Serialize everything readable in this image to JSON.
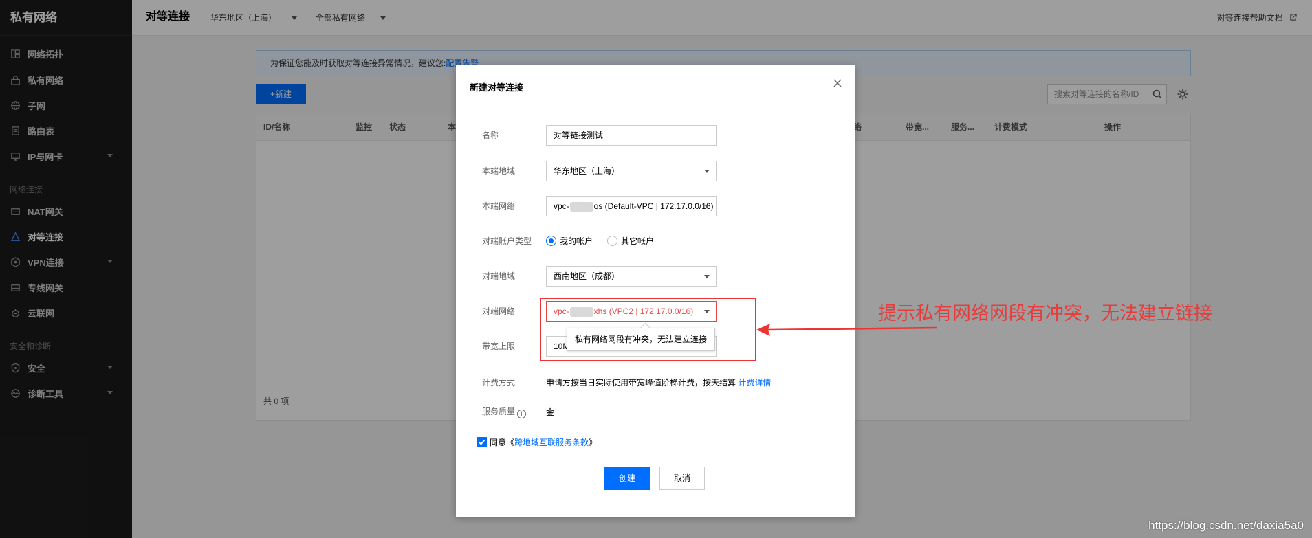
{
  "sidebar": {
    "brand": "私有网络",
    "items": [
      {
        "label": "网络拓扑",
        "icon": "topology-icon"
      },
      {
        "label": "私有网络",
        "icon": "lock-icon"
      },
      {
        "label": "子网",
        "icon": "globe-icon"
      },
      {
        "label": "路由表",
        "icon": "document-icon"
      },
      {
        "label": "IP与网卡",
        "icon": "network-card-icon"
      },
      {
        "label": "NAT网关",
        "icon": "gateway-icon"
      },
      {
        "label": "对等连接",
        "icon": "peering-icon"
      },
      {
        "label": "VPN连接",
        "icon": "vpn-icon"
      },
      {
        "label": "专线网关",
        "icon": "gateway-icon"
      },
      {
        "label": "云联网",
        "icon": "cloud-link-icon"
      },
      {
        "label": "安全",
        "icon": "shield-icon"
      },
      {
        "label": "诊断工具",
        "icon": "diagnose-icon"
      }
    ],
    "groups": [
      "网络连接",
      "安全和诊断"
    ]
  },
  "header": {
    "title": "对等连接",
    "region": "华东地区（上海）",
    "vpc_filter": "全部私有网络",
    "help": "对等连接帮助文档"
  },
  "notice": {
    "text": "为保证您能及时获取对等连接异常情况，建议您:",
    "link": "配置告警"
  },
  "toolbar": {
    "new_label": "+新建",
    "search_placeholder": "搜索对等连接的名称/ID"
  },
  "table": {
    "columns": [
      "ID/名称",
      "监控",
      "状态",
      "本",
      "络",
      "带宽...",
      "服务...",
      "计费模式",
      "操作"
    ],
    "total": "共 0 项"
  },
  "dialog": {
    "title": "新建对等连接",
    "name_label": "名称",
    "name_value": "对等链接测试",
    "local_region_label": "本端地域",
    "local_region_value": "华东地区（上海）",
    "local_vpc_label": "本端网络",
    "local_vpc_prefix": "vpc-",
    "local_vpc_suffix": "os (Default-VPC | 172.17.0.0/16)",
    "peer_account_label": "对端账户类型",
    "account_mine": "我的帐户",
    "account_other": "其它帐户",
    "peer_region_label": "对端地域",
    "peer_region_value": "西南地区（成都）",
    "peer_vpc_label": "对端网络",
    "peer_vpc_prefix": "vpc-",
    "peer_vpc_suffix": "xhs (VPC2 | 172.17.0.0/16)",
    "bandwidth_label": "带宽上限",
    "bandwidth_value": "10M",
    "tooltip": "私有网络网段有冲突，无法建立连接",
    "billing_label": "计费方式",
    "billing_text": "申请方按当日实际使用带宽峰值阶梯计费，按天结算",
    "billing_link": "计费详情",
    "quality_label": "服务质量",
    "quality_value": "金",
    "agree_text": "同意《",
    "agree_link": "跨地域互联服务条款",
    "agree_end": "》",
    "create_label": "创建",
    "cancel_label": "取消"
  },
  "annotation": {
    "text": "提示私有网络网段有冲突，无法建立链接",
    "color": "#e63c3c"
  },
  "watermark": "https://blog.csdn.net/daxia5a0",
  "colors": {
    "primary": "#006eff",
    "error": "#e54545",
    "sidebar": "#1b1b1b"
  }
}
